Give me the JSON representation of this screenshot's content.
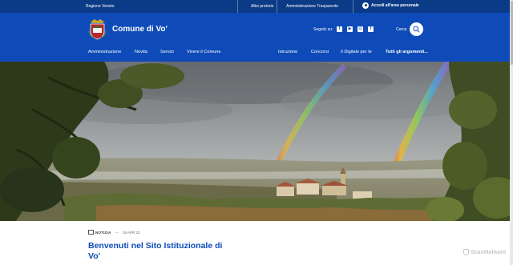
{
  "topbar": {
    "region": "Regione Veneto",
    "links": [
      "Albo pretorio",
      "Amministrazione Trasparente"
    ],
    "login": "Accedi all'area personale"
  },
  "header": {
    "title": "Comune di Vo'",
    "follow_label": "Seguici su:",
    "socials": [
      {
        "icon": "facebook-icon",
        "glyph": "f"
      },
      {
        "icon": "youtube-icon",
        "glyph": "▶"
      },
      {
        "icon": "instagram-icon",
        "glyph": "◎"
      },
      {
        "icon": "facebook-icon",
        "glyph": "f"
      }
    ],
    "search_label": "Cerca"
  },
  "nav": {
    "left": [
      "Amministrazione",
      "Novità",
      "Servizi",
      "Vivere il Comune"
    ],
    "right": [
      "Istruzione",
      "Concorsi",
      "Il Digitale per te"
    ],
    "all_topics": "Tutti gli argomenti..."
  },
  "article": {
    "category": "NOTIZIA",
    "date": "19 APR 23",
    "title": "Benvenuti nel Sito Istituzionale di Vo'"
  },
  "watermark": "ScanMalware",
  "colors": {
    "topbar": "#0b3a86",
    "header": "#0e4bb8",
    "title": "#0e4bb8"
  }
}
